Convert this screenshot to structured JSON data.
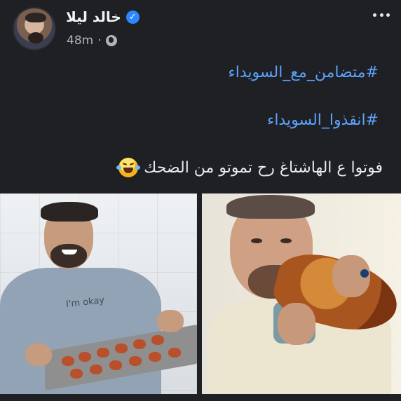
{
  "post": {
    "author_name": "خالد ليلا",
    "timestamp": "48m",
    "hashtags": [
      "#متضامن_مع_السويداء",
      "#انقذوا_السويداء"
    ],
    "caption": "فوتوا ع الهاشتاغ رح تموتو من الضحك",
    "emoji": "laughing-tears-icon"
  },
  "photos": {
    "left_shirt_text": "I'm okay"
  },
  "colors": {
    "background": "#1e2023",
    "hashtag": "#5da2ff",
    "verified": "#2d88ff"
  }
}
